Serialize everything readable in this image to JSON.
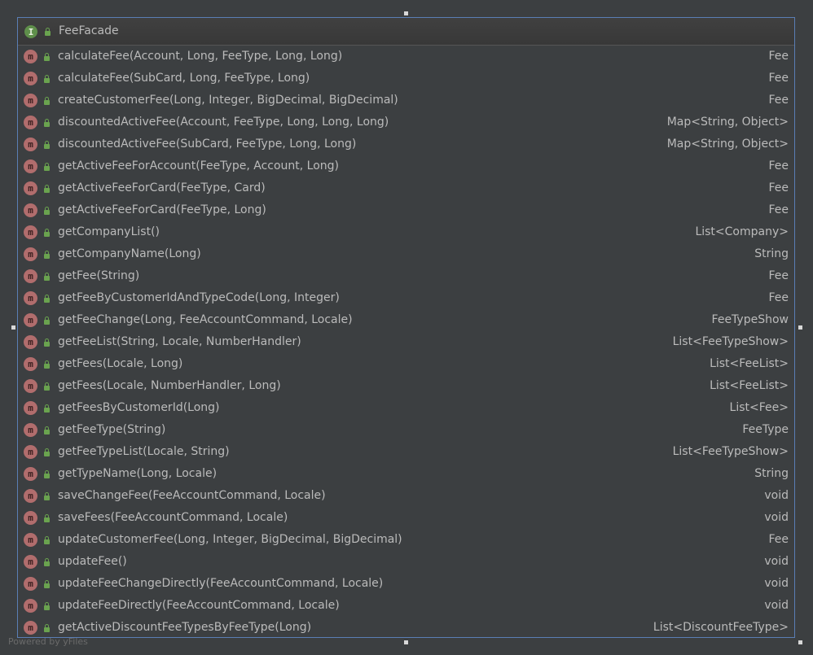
{
  "class_node": {
    "icon_letter": "I",
    "name": "FeeFacade",
    "method_icon_letter": "m",
    "methods": [
      {
        "signature": "calculateFee(Account, Long, FeeType, Long, Long)",
        "return_type": "Fee"
      },
      {
        "signature": "calculateFee(SubCard, Long, FeeType, Long)",
        "return_type": "Fee"
      },
      {
        "signature": "createCustomerFee(Long, Integer, BigDecimal, BigDecimal)",
        "return_type": "Fee"
      },
      {
        "signature": "discountedActiveFee(Account, FeeType, Long, Long, Long)",
        "return_type": "Map<String, Object>"
      },
      {
        "signature": "discountedActiveFee(SubCard, FeeType, Long, Long)",
        "return_type": "Map<String, Object>"
      },
      {
        "signature": "getActiveFeeForAccount(FeeType, Account, Long)",
        "return_type": "Fee"
      },
      {
        "signature": "getActiveFeeForCard(FeeType, Card)",
        "return_type": "Fee"
      },
      {
        "signature": "getActiveFeeForCard(FeeType, Long)",
        "return_type": "Fee"
      },
      {
        "signature": "getCompanyList()",
        "return_type": "List<Company>"
      },
      {
        "signature": "getCompanyName(Long)",
        "return_type": "String"
      },
      {
        "signature": "getFee(String)",
        "return_type": "Fee"
      },
      {
        "signature": "getFeeByCustomerIdAndTypeCode(Long, Integer)",
        "return_type": "Fee"
      },
      {
        "signature": "getFeeChange(Long, FeeAccountCommand, Locale)",
        "return_type": "FeeTypeShow"
      },
      {
        "signature": "getFeeList(String, Locale, NumberHandler)",
        "return_type": "List<FeeTypeShow>"
      },
      {
        "signature": "getFees(Locale, Long)",
        "return_type": "List<FeeList>"
      },
      {
        "signature": "getFees(Locale, NumberHandler, Long)",
        "return_type": "List<FeeList>"
      },
      {
        "signature": "getFeesByCustomerId(Long)",
        "return_type": "List<Fee>"
      },
      {
        "signature": "getFeeType(String)",
        "return_type": "FeeType"
      },
      {
        "signature": "getFeeTypeList(Locale, String)",
        "return_type": "List<FeeTypeShow>"
      },
      {
        "signature": "getTypeName(Long, Locale)",
        "return_type": "String"
      },
      {
        "signature": "saveChangeFee(FeeAccountCommand, Locale)",
        "return_type": "void"
      },
      {
        "signature": "saveFees(FeeAccountCommand, Locale)",
        "return_type": "void"
      },
      {
        "signature": "updateCustomerFee(Long, Integer, BigDecimal, BigDecimal)",
        "return_type": "Fee"
      },
      {
        "signature": "updateFee()",
        "return_type": "void"
      },
      {
        "signature": "updateFeeChangeDirectly(FeeAccountCommand, Locale)",
        "return_type": "void"
      },
      {
        "signature": "updateFeeDirectly(FeeAccountCommand, Locale)",
        "return_type": "void"
      },
      {
        "signature": "getActiveDiscountFeeTypesByFeeType(Long)",
        "return_type": "List<DiscountFeeType>"
      }
    ]
  },
  "footer": {
    "text": "Powered by yFiles"
  },
  "colors": {
    "canvas_bg": "#3c3f41",
    "selection_border": "#5a7eb5",
    "interface_icon": "#5f8f4b",
    "method_icon": "#b16d6d",
    "public_lock": "#6aa34f",
    "text": "#bbbbbb"
  },
  "icons": {
    "interface": "interface-icon",
    "method": "method-icon",
    "visibility": "public-lock-icon"
  }
}
